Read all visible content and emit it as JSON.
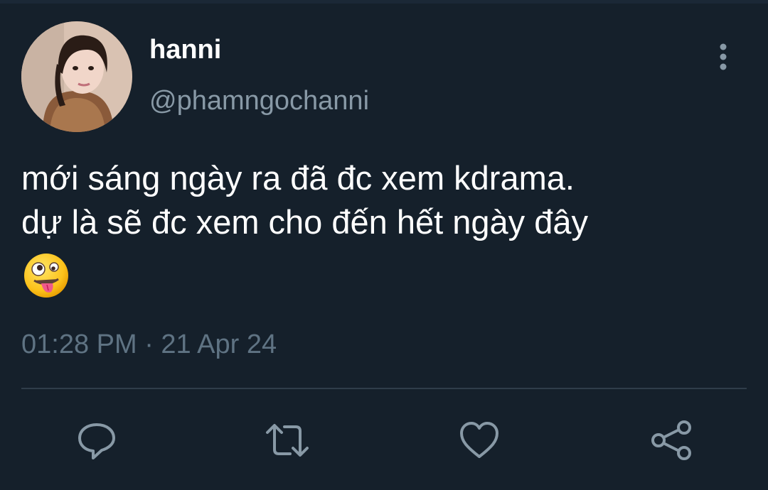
{
  "tweet": {
    "author": {
      "display_name": "hanni",
      "handle": "@phamngochanni",
      "avatar_icon": "profile-photo"
    },
    "text_lines": [
      "mới sáng ngày ra đã đc xem kdrama.",
      "dự là sẽ đc xem cho đến hết ngày đây"
    ],
    "emoji": "🤪",
    "timestamp": "01:28 PM · 21 Apr 24"
  },
  "actions": [
    {
      "name": "reply",
      "icon": "speech-bubble-icon"
    },
    {
      "name": "retweet",
      "icon": "retweet-arrows-icon"
    },
    {
      "name": "like",
      "icon": "heart-icon"
    },
    {
      "name": "share",
      "icon": "share-nodes-icon"
    }
  ],
  "colors": {
    "background": "#15202b",
    "primary_text": "#ffffff",
    "secondary_text": "#8899a6",
    "timestamp_text": "#5f7383",
    "icon": "#8899a6",
    "divider": "#2f3d4a"
  }
}
